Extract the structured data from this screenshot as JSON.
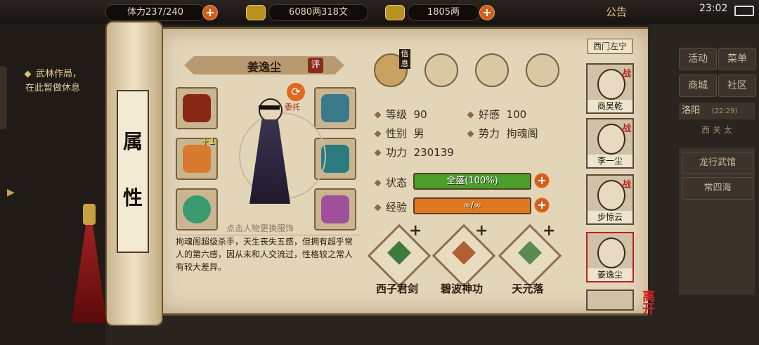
{
  "topbar": {
    "stamina": "体力237/240",
    "copper": "6080两318文",
    "silver": "1805两",
    "announcement": "公告",
    "time": "23:02"
  },
  "left_notice": {
    "line1": "武林作局，",
    "line2": "在此暂做休息"
  },
  "scroll_title": [
    "属",
    "性"
  ],
  "character": {
    "name": "姜逸尘",
    "review_badge": "评",
    "entrust": "委托",
    "change_outfit_hint": "点击人物更换服饰",
    "description": "拘魂阁超级杀手，天生丧失五感，但拥有超乎常人的第六感，因从未和人交流过，性格较之常人有较大差异。",
    "equip_plus": "+1"
  },
  "tabs": [
    {
      "id": "info",
      "label": "信息"
    },
    {
      "id": "scroll",
      "label": ""
    },
    {
      "id": "bagua",
      "label": ""
    },
    {
      "id": "body",
      "label": ""
    }
  ],
  "stats": {
    "level_label": "等级",
    "level": "90",
    "affinity_label": "好感",
    "affinity": "100",
    "gender_label": "性别",
    "gender": "男",
    "faction_label": "势力",
    "faction": "拘魂阁",
    "power_label": "功力",
    "power": "230139",
    "state_label": "状态",
    "state": "全盛(100%)",
    "state_fill": 1.0,
    "exp_label": "经验",
    "exp": "∞/∞",
    "exp_fill": 1.0
  },
  "skills": [
    {
      "name": "西子君剑",
      "color": "#3e7a3a"
    },
    {
      "name": "碧波神功",
      "color": "#b06030"
    },
    {
      "name": "天元落",
      "color": "#5a8a50"
    }
  ],
  "right_panel": {
    "npc_name": "西门左宁",
    "buttons": [
      "活动",
      "菜单",
      "商城",
      "社区"
    ],
    "location": "洛阳",
    "location_time": "(22:29)",
    "tabs_hint": "西 关 太",
    "places": [
      "龙行武馆",
      "常四海"
    ]
  },
  "party": [
    {
      "name": "商吴乾",
      "war": "战"
    },
    {
      "name": "李一尘",
      "war": "战"
    },
    {
      "name": "步惊云",
      "war": "战"
    },
    {
      "name": "姜逸尘",
      "war": ""
    }
  ],
  "leave": "离开",
  "colors": {
    "state_bar": "#4aa028",
    "exp_bar": "#e07820",
    "name_banner": "#b89a70"
  }
}
